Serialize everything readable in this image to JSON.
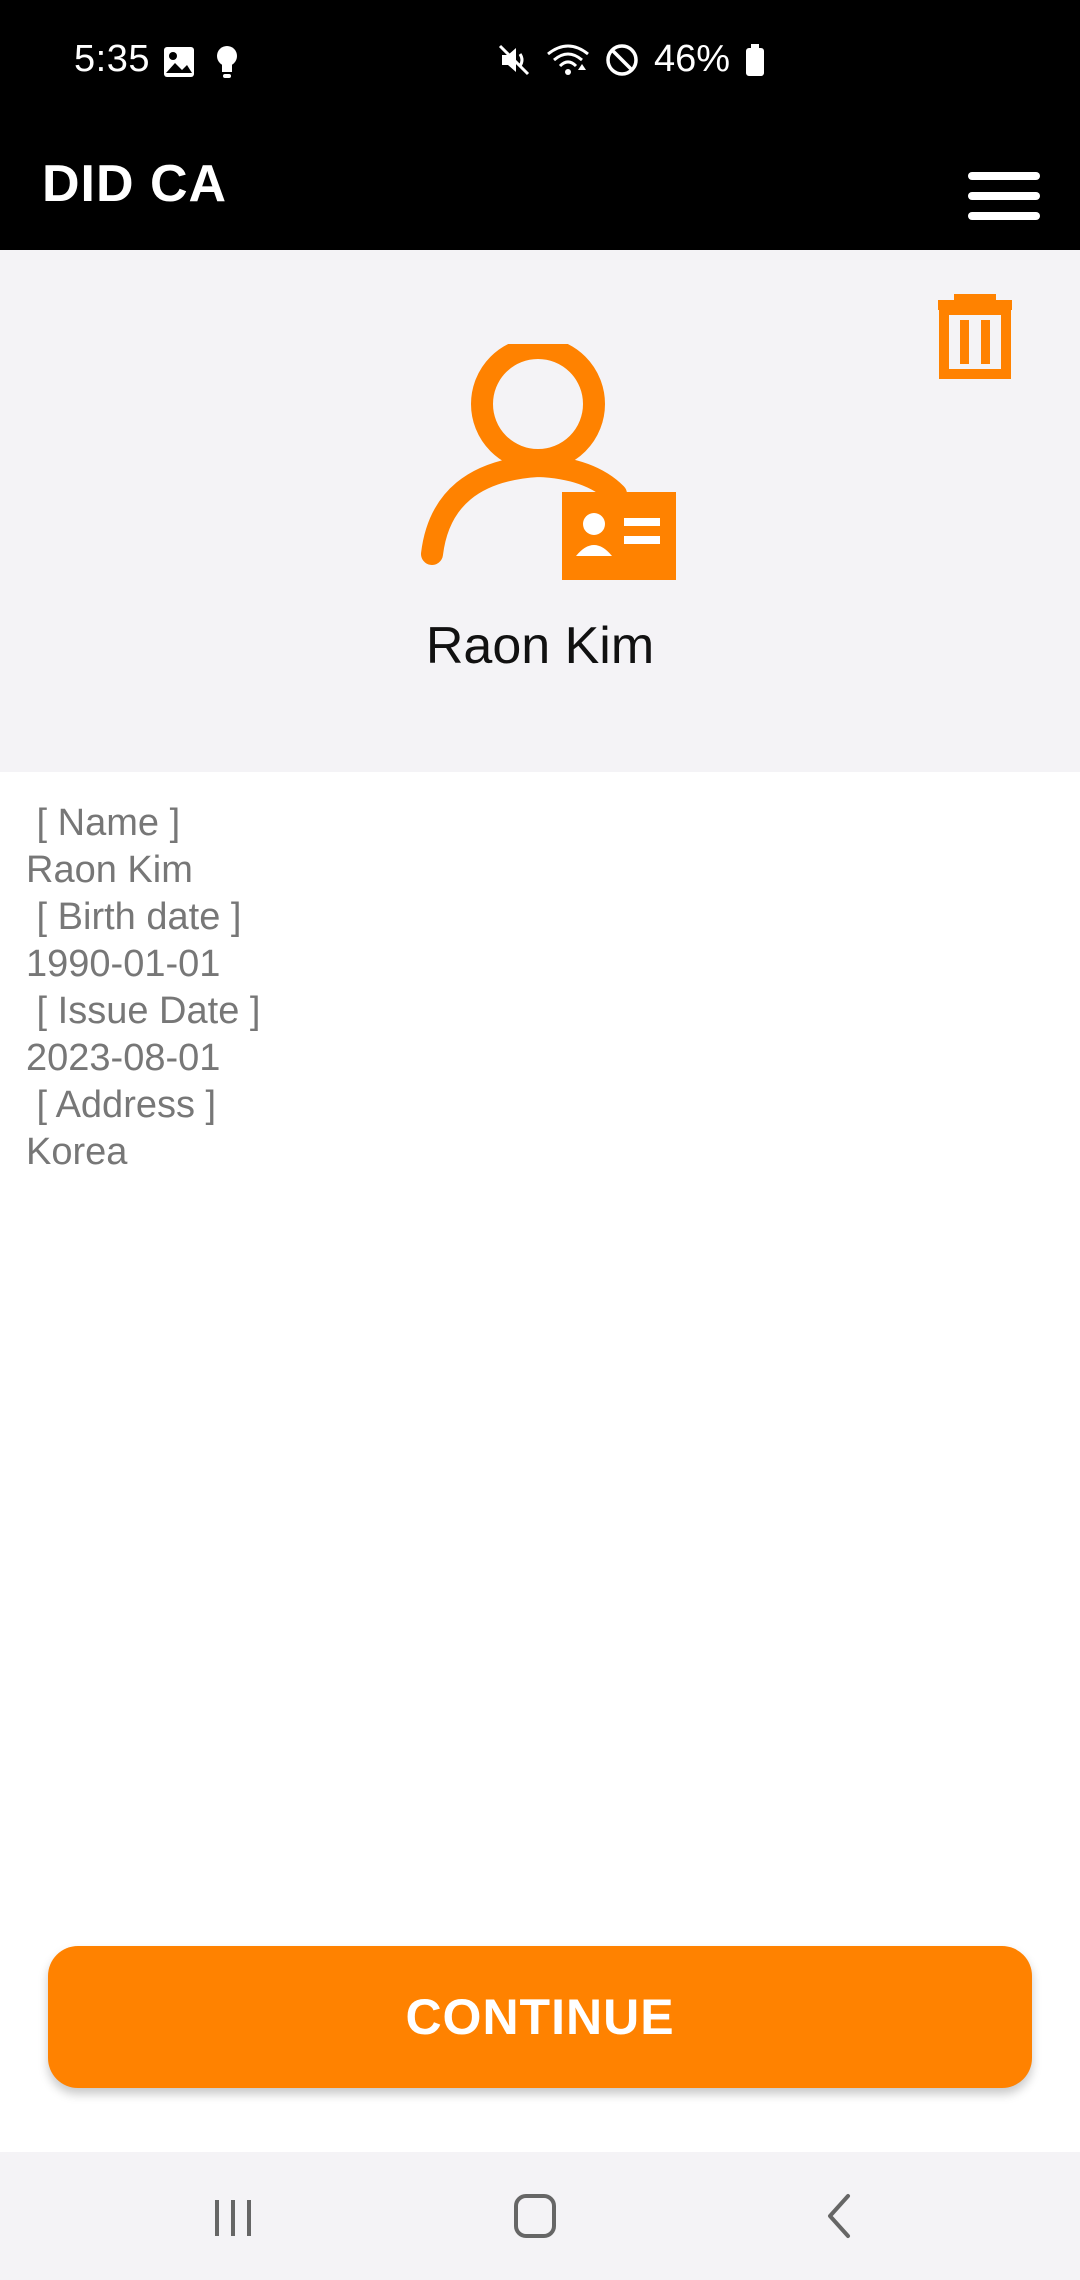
{
  "status_bar": {
    "time": "5:35",
    "battery": "46%",
    "icons": [
      "image-icon",
      "bulb-icon",
      "mute-icon",
      "wifi-icon",
      "dnd-icon",
      "battery-icon"
    ]
  },
  "app_bar": {
    "title": "DID CA",
    "menu_icon": "hamburger-menu-icon"
  },
  "profile": {
    "name": "Raon Kim",
    "avatar_icon": "user-id-card-icon",
    "delete_icon": "trash-icon"
  },
  "details": {
    "name_label": " [ Name ]",
    "name_value": "Raon Kim",
    "birth_label": " [ Birth date ]",
    "birth_value": "1990-01-01",
    "issue_label": " [ Issue Date ]",
    "issue_value": "2023-08-01",
    "address_label": " [ Address ]",
    "address_value": "Korea"
  },
  "actions": {
    "continue_label": "CONTINUE"
  },
  "nav": {
    "icons": [
      "recents-icon",
      "home-icon",
      "back-icon"
    ]
  },
  "colors": {
    "accent": "#ff8200",
    "bar": "#000000",
    "header_bg": "#f4f3f6",
    "detail_text": "#777777"
  }
}
